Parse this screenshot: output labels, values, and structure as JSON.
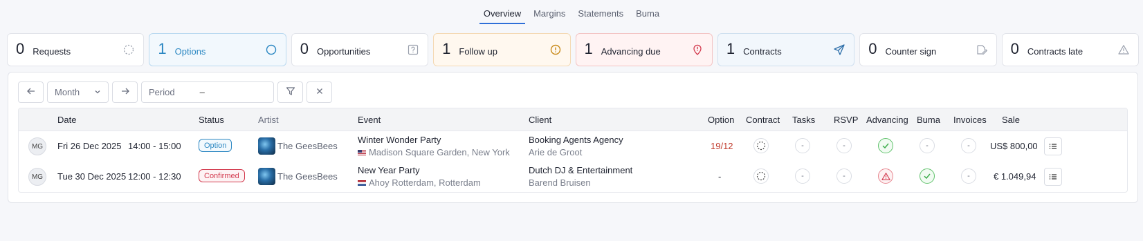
{
  "tabs": [
    {
      "label": "Overview",
      "active": true
    },
    {
      "label": "Margins",
      "active": false
    },
    {
      "label": "Statements",
      "active": false
    },
    {
      "label": "Buma",
      "active": false
    }
  ],
  "stats": [
    {
      "count": "0",
      "label": "Requests",
      "icon": "dashed-circle-icon"
    },
    {
      "count": "1",
      "label": "Options",
      "icon": "circle-icon"
    },
    {
      "count": "0",
      "label": "Opportunities",
      "icon": "question-box-icon"
    },
    {
      "count": "1",
      "label": "Follow up",
      "icon": "alert-circle-icon"
    },
    {
      "count": "1",
      "label": "Advancing due",
      "icon": "map-pin-alert-icon"
    },
    {
      "count": "1",
      "label": "Contracts",
      "icon": "send-icon"
    },
    {
      "count": "0",
      "label": "Counter sign",
      "icon": "signature-icon"
    },
    {
      "count": "0",
      "label": "Contracts late",
      "icon": "warning-triangle-icon"
    }
  ],
  "filters": {
    "period_unit": "Month",
    "period_placeholder": "Period",
    "period_separator": "–"
  },
  "table": {
    "headers": {
      "date": "Date",
      "status": "Status",
      "artist": "Artist",
      "event": "Event",
      "client": "Client",
      "option": "Option",
      "contract": "Contract",
      "tasks": "Tasks",
      "rsvp": "RSVP",
      "advancing": "Advancing",
      "buma": "Buma",
      "invoices": "Invoices",
      "sale": "Sale"
    },
    "rows": [
      {
        "initials": "MG",
        "date": "Fri 26 Dec 2025",
        "time": "14:00 - 15:00",
        "status": "Option",
        "artist": "The GeesBees",
        "event": "Winter Wonder Party",
        "venue": "Madison Square Garden, New York",
        "client": "Booking Agents Agency",
        "contact": "Arie de Groot",
        "option": "19/12",
        "tasks": "-",
        "rsvp": "-",
        "buma": "-",
        "invoices": "-",
        "sale": "US$ 800,00"
      },
      {
        "initials": "MG",
        "date": "Tue 30 Dec 2025",
        "time": "12:00 - 12:30",
        "status": "Confirmed",
        "artist": "The GeesBees",
        "event": "New Year Party",
        "venue": "Ahoy Rotterdam, Rotterdam",
        "client": "Dutch DJ & Entertainment",
        "contact": "Barend Bruisen",
        "option": "-",
        "tasks": "-",
        "rsvp": "-",
        "invoices": "-",
        "sale": "€ 1.049,94"
      }
    ]
  },
  "colors": {
    "accent": "#2f6fd8",
    "option_blue": "#2b87c2",
    "confirmed_red": "#d33a4e",
    "ok_green": "#5fc26b",
    "option_date_red": "#c0392b"
  }
}
